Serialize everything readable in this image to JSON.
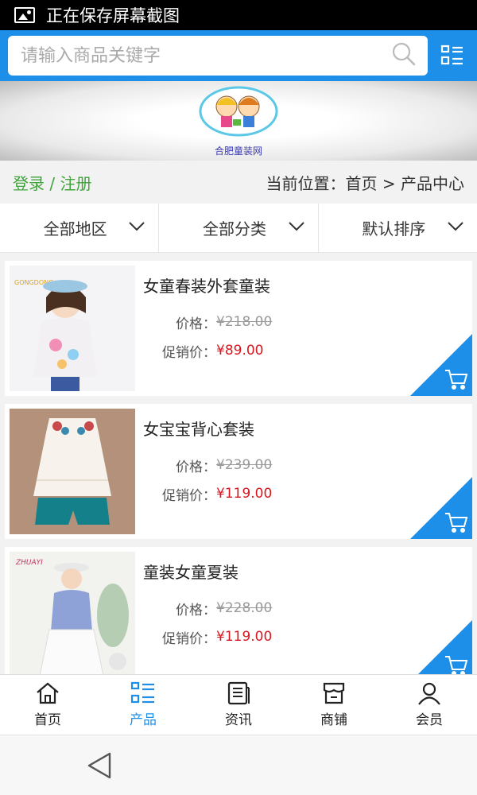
{
  "statusbar": {
    "text": "正在保存屏幕截图",
    "icon": "image-icon"
  },
  "search": {
    "placeholder": "请输入商品关键字"
  },
  "banner": {
    "logo_text": "合肥童装网"
  },
  "crumb": {
    "login": "登录",
    "sep": " / ",
    "register": "注册",
    "location": "当前位置：首页 > 产品中心"
  },
  "filters": [
    {
      "label": "全部地区"
    },
    {
      "label": "全部分类"
    },
    {
      "label": "默认排序"
    }
  ],
  "products": [
    {
      "title": "女童春装外套童装",
      "price_label": "价格：",
      "price": "¥218.00",
      "sale_label": "促销价：",
      "sale": "¥89.00",
      "brand": "GONGDONG"
    },
    {
      "title": "女宝宝背心套装",
      "price_label": "价格：",
      "price": "¥239.00",
      "sale_label": "促销价：",
      "sale": "¥119.00"
    },
    {
      "title": "童装女童夏装",
      "price_label": "价格：",
      "price": "¥228.00",
      "sale_label": "促销价：",
      "sale": "¥119.00",
      "brand": "ZHUAYI"
    }
  ],
  "nav": [
    {
      "label": "首页",
      "icon": "home-icon"
    },
    {
      "label": "产品",
      "icon": "list-icon"
    },
    {
      "label": "资讯",
      "icon": "news-icon"
    },
    {
      "label": "商铺",
      "icon": "shop-icon"
    },
    {
      "label": "会员",
      "icon": "user-icon"
    }
  ],
  "colors": {
    "primary": "#1e8fe8",
    "sale": "#d7161f",
    "login": "#3ea43a"
  }
}
